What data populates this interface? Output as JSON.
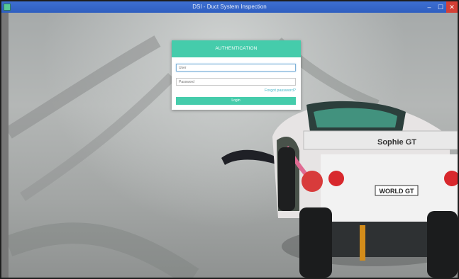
{
  "window": {
    "title": "DSI - Duct System Inspection",
    "minimize": "–",
    "maximize": "☐",
    "close": "✕"
  },
  "scene": {
    "car_label_rear": "Sophie GT",
    "car_plate": "WORLD GT"
  },
  "login": {
    "header": "AUTHENTICATION",
    "username_placeholder": "User",
    "password_placeholder": "Password",
    "forgot_link": "Forgot password?",
    "login_button": "Login"
  },
  "colors": {
    "accent": "#45ccab",
    "titlebar": "#2f5fc0",
    "close_button": "#d44036"
  },
  "icons": {
    "app": "app-icon",
    "minimize": "minimize-icon",
    "maximize": "maximize-icon",
    "close": "close-icon"
  }
}
